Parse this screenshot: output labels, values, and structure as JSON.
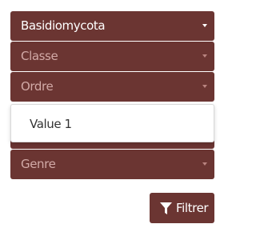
{
  "selects": [
    {
      "value": "Basidiomycota"
    },
    {
      "value": "Classe"
    },
    {
      "value": "Ordre"
    },
    {
      "value": ""
    },
    {
      "value": "Genre"
    }
  ],
  "dropdown": {
    "options": [
      "Value 1"
    ]
  },
  "filter_button": {
    "label": "Filtrer",
    "icon": "filter-icon"
  },
  "colors": {
    "accent": "#6b3532",
    "placeholder": "#d2aaa7"
  }
}
